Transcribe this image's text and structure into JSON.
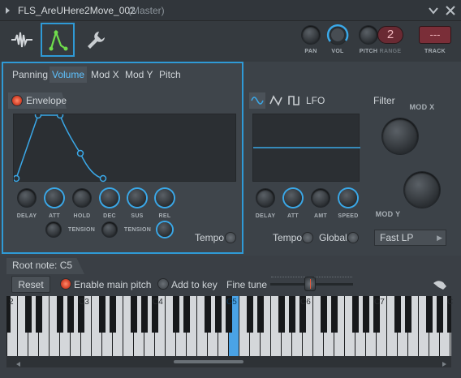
{
  "window": {
    "title": "FLS_AreUHere2Move_002",
    "subtitle": "(Master)"
  },
  "toolbar": {
    "knobs": {
      "pan": "PAN",
      "vol": "VOL",
      "pitch": "PITCH",
      "range": "RANGE",
      "track": "TRACK"
    },
    "range_value": "2",
    "track_value": "---"
  },
  "tabs": [
    "Panning",
    "Volume",
    "Mod X",
    "Mod Y",
    "Pitch"
  ],
  "active_tab": "Volume",
  "envelope": {
    "label": "Envelope",
    "knobs": [
      "DELAY",
      "ATT",
      "HOLD",
      "DEC",
      "SUS",
      "REL"
    ],
    "tension1": "TENSION",
    "tension2": "TENSION",
    "tempo": "Tempo"
  },
  "lfo": {
    "label": "LFO",
    "knobs": [
      "DELAY",
      "ATT",
      "AMT",
      "SPEED"
    ],
    "tempo": "Tempo",
    "global": "Global"
  },
  "filter": {
    "label": "Filter",
    "modx": "MOD X",
    "mody": "MOD Y",
    "type": "Fast LP"
  },
  "root": {
    "label": "Root note: C5",
    "reset": "Reset",
    "enable_main_pitch": "Enable main pitch",
    "add_to_key": "Add to key",
    "fine_tune": "Fine tune"
  },
  "piano": {
    "labels": [
      "2",
      "C3",
      "C4",
      "C5",
      "C6",
      "C7",
      "C"
    ]
  },
  "colors": {
    "accent": "#2f9ad6",
    "highlight_text": "#5ec2ff",
    "led_on": "#d6432a",
    "selected_key": "#4aa3e6"
  }
}
